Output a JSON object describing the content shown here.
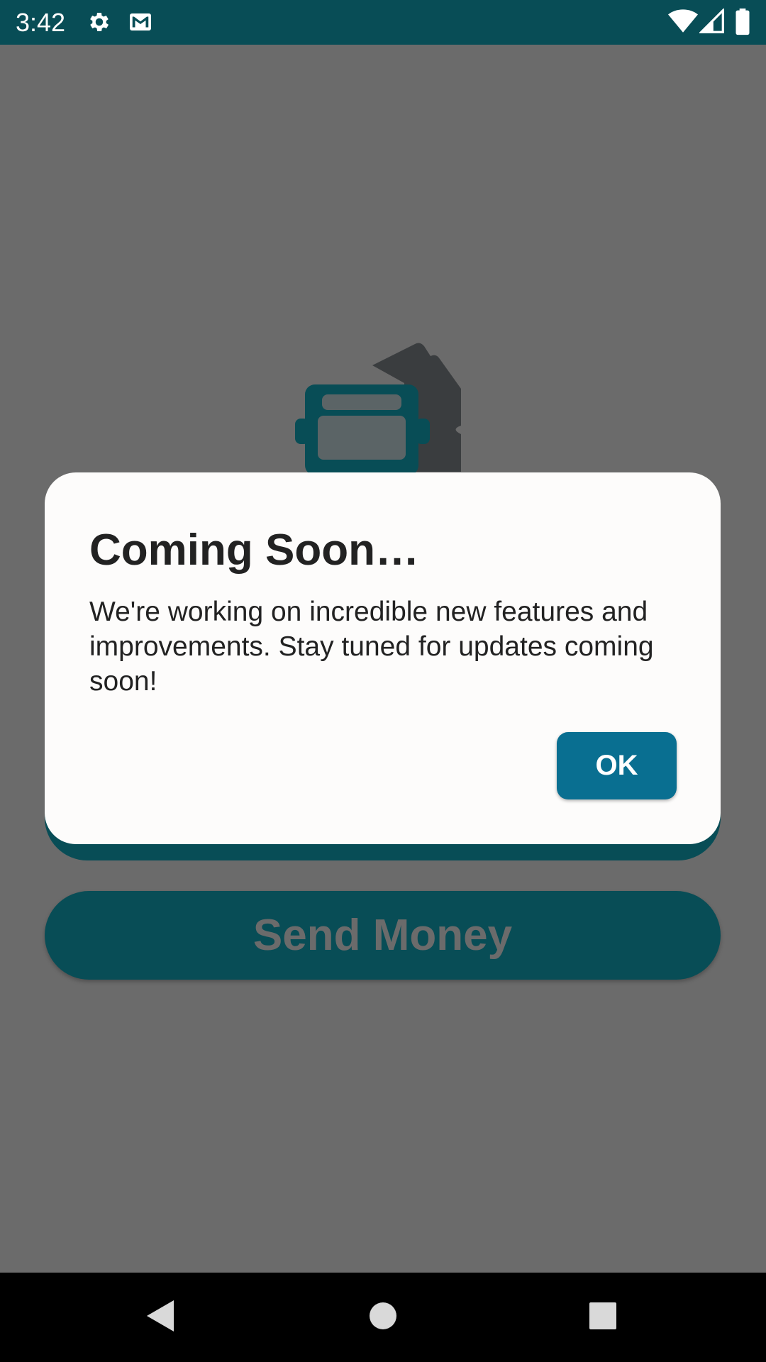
{
  "status_bar": {
    "time": "3:42",
    "left_icons": [
      "gear-icon",
      "gmail-icon"
    ],
    "right_icons": [
      "wifi-icon",
      "cell-signal-icon",
      "battery-icon"
    ]
  },
  "background": {
    "send_money_label": "Send Money",
    "illustration_icon": "bus-ticket-icon"
  },
  "dialog": {
    "title": "Coming Soon…",
    "message": "We're working on incredible new features and improvements. Stay tuned for updates coming soon!",
    "ok_label": "OK"
  },
  "nav_bar": {
    "items": [
      "back-icon",
      "home-icon",
      "recents-icon"
    ]
  },
  "colors": {
    "status_bar": "#084d56",
    "scrim": "#6b6b6b",
    "dialog_bg": "#fdfcfb",
    "ok_button": "#096f91",
    "primary_button": "#084d56"
  }
}
